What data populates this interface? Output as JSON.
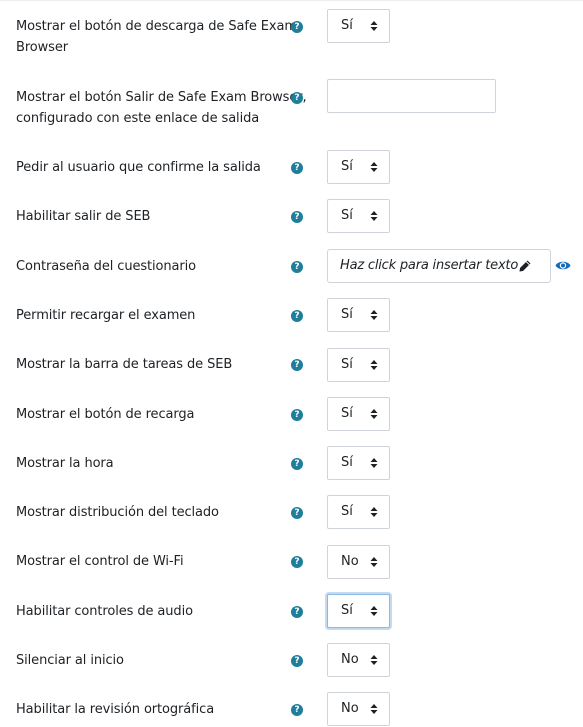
{
  "icons": {
    "help": "question-circle-icon",
    "caret": "sort-caret-icon",
    "pencil": "pencil-icon",
    "eye": "eye-icon"
  },
  "colors": {
    "help_icon": "#1f7e9a",
    "eye_icon": "#0f6cbf",
    "text": "#1d2125",
    "border": "#ced4da",
    "focus": "#8cb8e6"
  },
  "fields": [
    {
      "label_line1": "Mostrar el botón de descarga de Safe Exam",
      "label_line2": "Browser",
      "help": "?",
      "value": "Sí"
    },
    {
      "label_line1": "Mostrar el botón Salir de Safe Exam Browser,",
      "label_line2": "configurado con este enlace de salida",
      "help": "?",
      "value": ""
    },
    {
      "label": "Pedir al usuario que confirme la salida",
      "help": "?",
      "value": "Sí"
    },
    {
      "label": "Habilitar salir de SEB",
      "help": "?",
      "value": "Sí"
    },
    {
      "label": "Contraseña del cuestionario",
      "help": "?",
      "value": "Haz click para insertar texto"
    },
    {
      "label": "Permitir recargar el examen",
      "help": "?",
      "value": "Sí"
    },
    {
      "label": "Mostrar la barra de tareas de SEB",
      "help": "?",
      "value": "Sí"
    },
    {
      "label": "Mostrar el botón de recarga",
      "help": "?",
      "value": "Sí"
    },
    {
      "label": "Mostrar la hora",
      "help": "?",
      "value": "Sí"
    },
    {
      "label": "Mostrar distribución del teclado",
      "help": "?",
      "value": "Sí"
    },
    {
      "label": "Mostrar el control de Wi-Fi",
      "help": "?",
      "value": "No"
    },
    {
      "label": "Habilitar controles de audio",
      "help": "?",
      "value": "Sí"
    },
    {
      "label": "Silenciar al inicio",
      "help": "?",
      "value": "No"
    },
    {
      "label": "Habilitar la revisión ortográfica",
      "help": "?",
      "value": "No"
    }
  ]
}
